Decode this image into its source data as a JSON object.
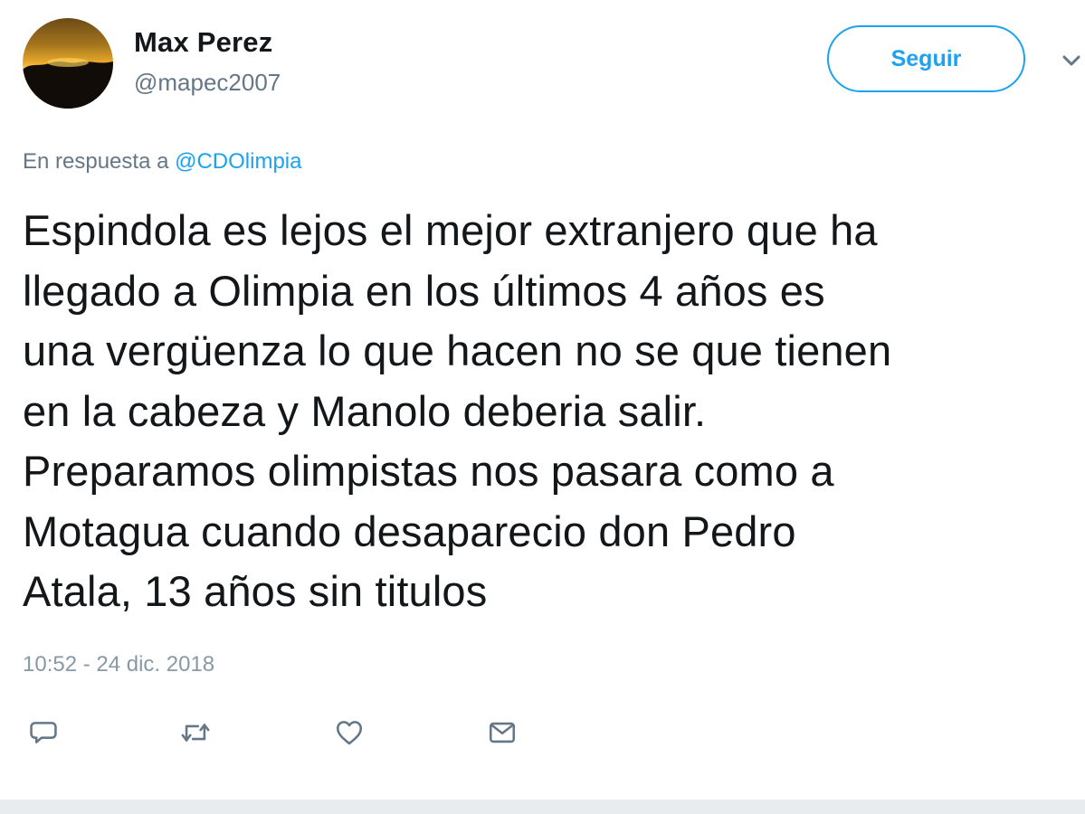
{
  "user": {
    "name": "Max Perez",
    "handle": "@mapec2007",
    "avatar_icon": "sunset-avatar"
  },
  "follow_button": {
    "label": "Seguir"
  },
  "reply": {
    "prefix": "En respuesta a",
    "mention": "@CDOlimpia"
  },
  "tweet": {
    "text": "Espindola es lejos el mejor extranjero que ha\nllegado a Olimpia en los últimos 4 años es\nuna vergüenza lo que hacen no se que tienen\nen la cabeza y Manolo deberia salir.\nPreparamos olimpistas nos pasara como a\nMotagua cuando desaparecio don Pedro\nAtala, 13 años sin titulos",
    "timestamp": "10:52 - 24 dic. 2018"
  },
  "actions": [
    {
      "icon": "reply-icon"
    },
    {
      "icon": "retweet-icon"
    },
    {
      "icon": "heart-icon"
    },
    {
      "icon": "direct-message-icon"
    }
  ],
  "colors": {
    "text": "#14171a",
    "secondary": "#657786",
    "accent": "#1da1f2",
    "action_icon": "#657786"
  }
}
